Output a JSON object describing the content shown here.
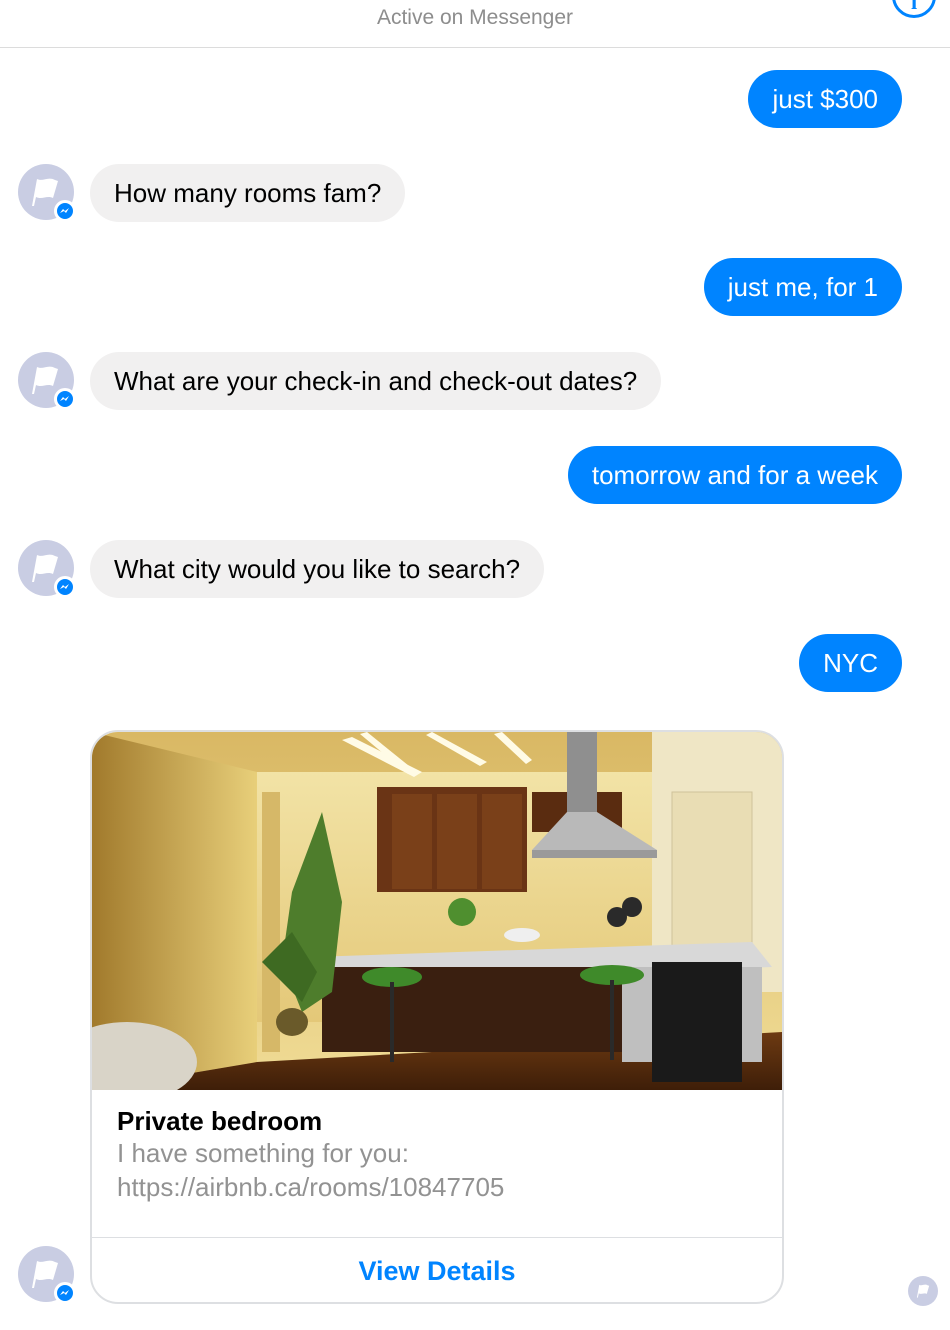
{
  "header": {
    "status": "Active on Messenger",
    "info_icon": "info-icon",
    "info_glyph": "i"
  },
  "messages": [
    {
      "from": "user",
      "text": "just $300"
    },
    {
      "from": "bot",
      "text": "How many rooms fam?"
    },
    {
      "from": "user",
      "text": "just me, for 1"
    },
    {
      "from": "bot",
      "text": "What are your check-in and check-out dates?"
    },
    {
      "from": "user",
      "text": "tomorrow and for a week"
    },
    {
      "from": "bot",
      "text": "What city would you like to search?"
    },
    {
      "from": "user",
      "text": "NYC"
    }
  ],
  "card": {
    "title": "Private bedroom",
    "subtitle": "I have something for you:",
    "url": "https://airbnb.ca/rooms/10847705",
    "button_label": "View Details"
  },
  "colors": {
    "accent": "#0084ff",
    "incoming_bubble": "#f1f0f0",
    "avatar": "#c9cde3",
    "muted_text": "#929292"
  }
}
